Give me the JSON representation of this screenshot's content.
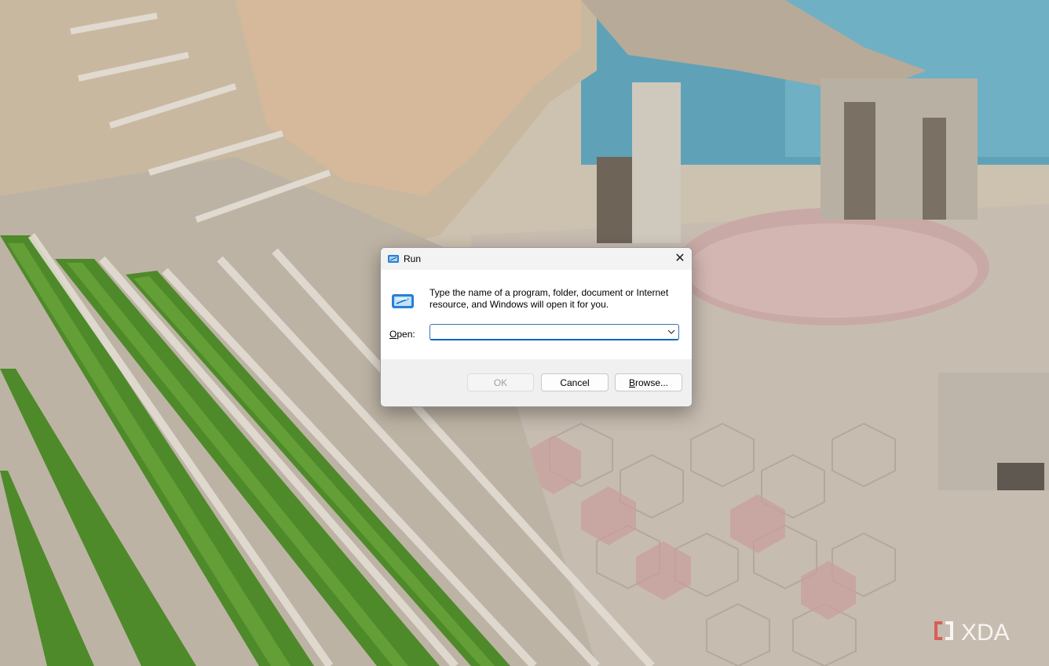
{
  "window": {
    "title": "Run",
    "close_icon": "close-icon",
    "app_icon": "run-icon"
  },
  "dialog": {
    "description": "Type the name of a program, folder, document or Internet resource, and Windows will open it for you.",
    "open_label_prefix": "",
    "open_label_accel": "O",
    "open_label_rest": "pen:",
    "open_value": "",
    "dropdown_icon": "chevron-down-icon"
  },
  "buttons": {
    "ok": "OK",
    "cancel": "Cancel",
    "browse_accel": "B",
    "browse_rest": "rowse..."
  },
  "watermark": {
    "text": "XDA"
  },
  "colors": {
    "accent": "#0067c0",
    "dialog_bg": "#f0f0f0",
    "body_bg": "#ffffff"
  }
}
